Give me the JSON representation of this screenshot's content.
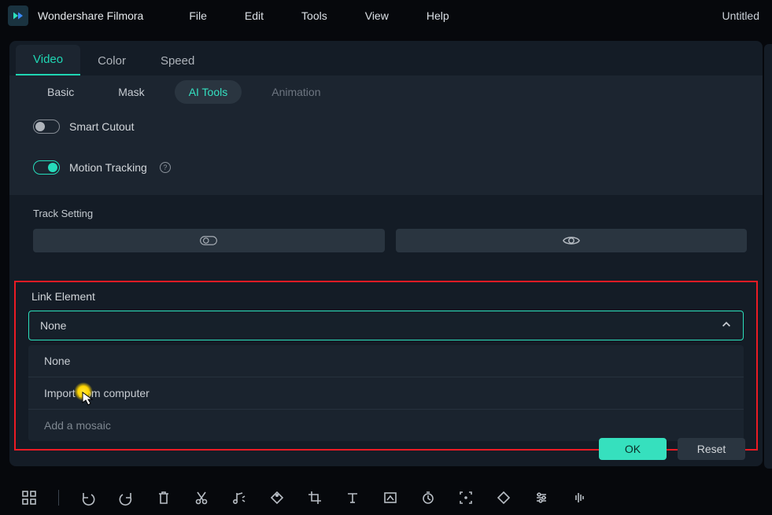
{
  "app": {
    "name": "Wondershare Filmora",
    "doc_title": "Untitled"
  },
  "menu": {
    "file": "File",
    "edit": "Edit",
    "tools": "Tools",
    "view": "View",
    "help": "Help"
  },
  "ptabs": {
    "video": "Video",
    "color": "Color",
    "speed": "Speed"
  },
  "subtabs": {
    "basic": "Basic",
    "mask": "Mask",
    "aitools": "AI Tools",
    "animation": "Animation"
  },
  "opts": {
    "smart_cutout": "Smart Cutout",
    "motion_tracking": "Motion Tracking"
  },
  "track": {
    "label": "Track Setting"
  },
  "link": {
    "label": "Link Element",
    "selected": "None",
    "options": {
      "none": "None",
      "import": "Import from computer",
      "mosaic": "Add a mosaic"
    }
  },
  "buttons": {
    "ok": "OK",
    "reset": "Reset"
  }
}
